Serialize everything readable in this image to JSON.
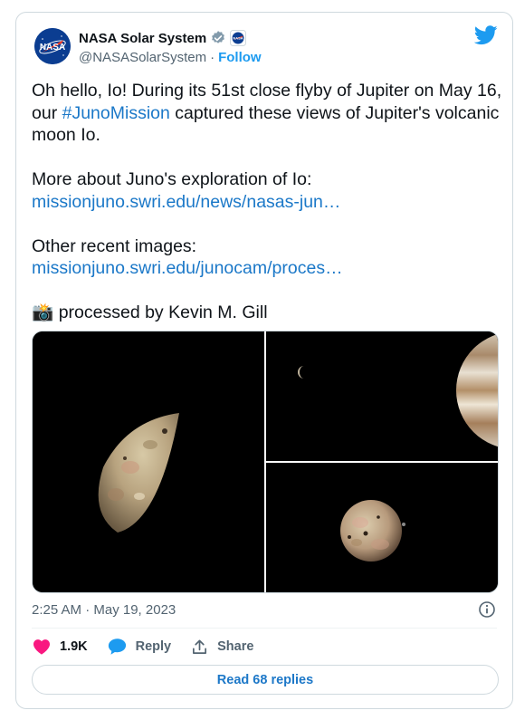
{
  "tweet": {
    "author": {
      "name": "NASA Solar System",
      "handle": "@NASASolarSystem",
      "separator": "·",
      "follow_label": "Follow",
      "avatar_label": "NASA"
    },
    "text": {
      "para1_a": "Oh hello, Io! During its 51st close flyby of Jupiter on May 16, our ",
      "hashtag": "#JunoMission",
      "para1_b": " captured these views of Jupiter's volcanic moon Io.",
      "para2": "More about Juno's exploration of Io:",
      "link1": "missionjuno.swri.edu/news/nasas-jun…",
      "para3": "Other recent images:",
      "link2": "missionjuno.swri.edu/junocam/proces…",
      "camera_emoji": "📸",
      "credit": " processed by Kevin M. Gill"
    },
    "timestamp": "2:25 AM · May 19, 2023",
    "likes": "1.9K",
    "reply_label": "Reply",
    "share_label": "Share",
    "read_replies": "Read 68 replies"
  },
  "colors": {
    "accent": "#1d9bf0",
    "link": "#1b78c8",
    "like": "#f91880",
    "muted": "#536471",
    "border": "#cfd9de"
  },
  "icons": [
    "nasa-logo",
    "verified-badge-icon",
    "affiliate-badge-icon",
    "twitter-bird-icon",
    "info-icon",
    "heart-icon",
    "reply-bubble-icon",
    "share-icon"
  ]
}
